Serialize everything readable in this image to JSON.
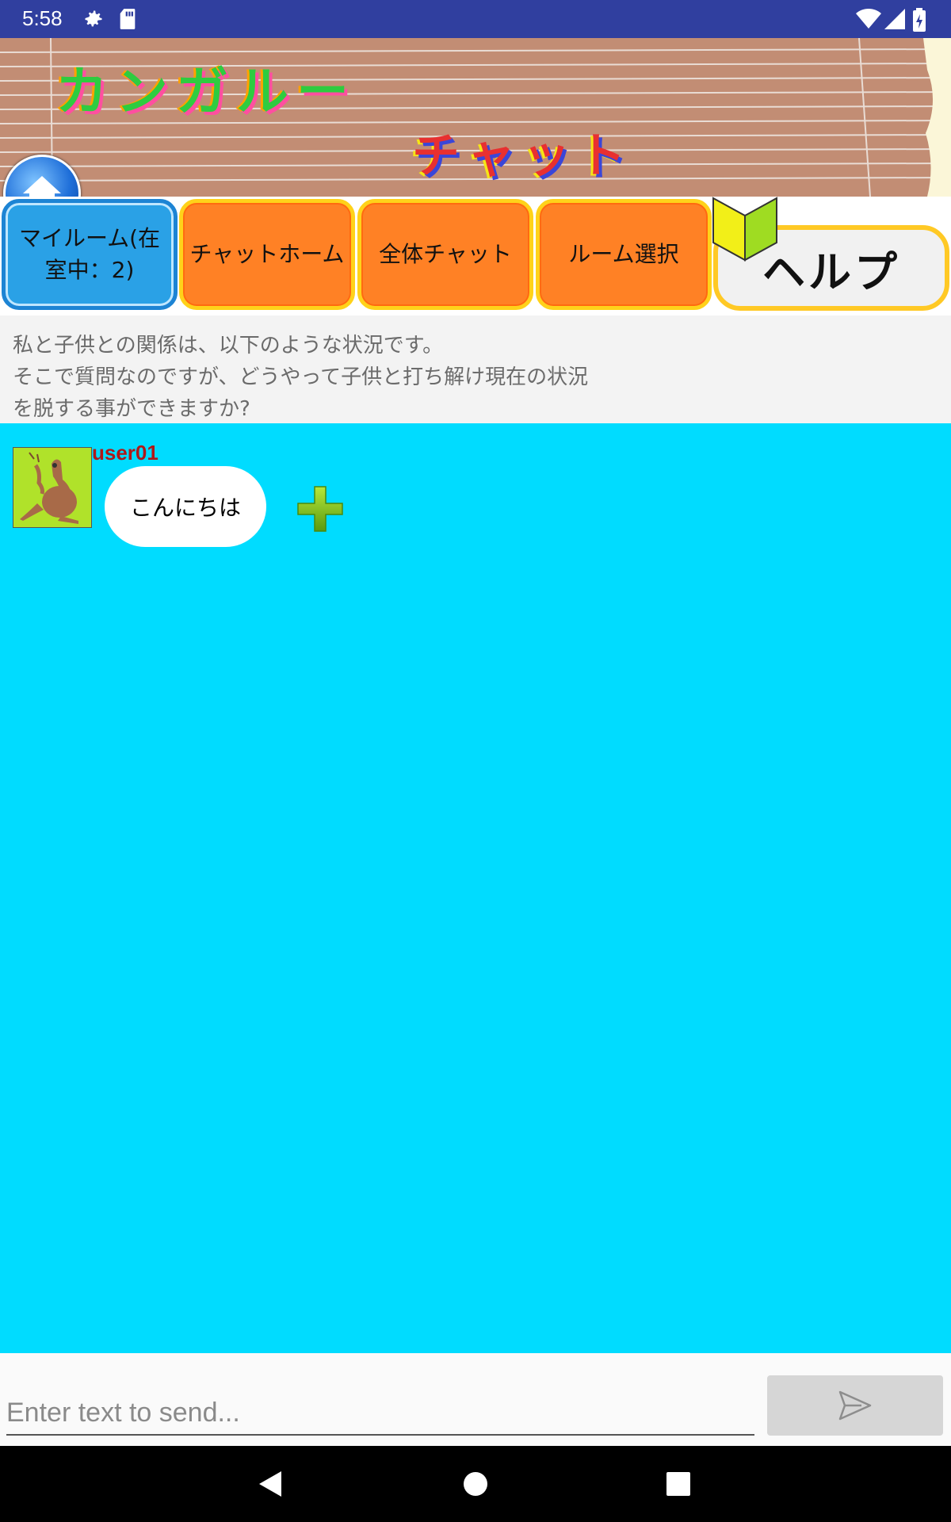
{
  "status_bar": {
    "time": "5:58",
    "icons": [
      "gear-icon",
      "sd-card-icon",
      "wifi-icon",
      "signal-icon",
      "battery-icon"
    ]
  },
  "banner": {
    "title_line1": "カンガルー",
    "title_line2": "チャット",
    "home_icon": "home-icon"
  },
  "nav": {
    "my_room": "マイルーム(在室中：2)",
    "chat_home": "チャットホーム",
    "all_chat": "全体チャット",
    "room_select": "ルーム選択",
    "help": "ヘルプ"
  },
  "topic": {
    "lines": [
      "私と子供との関係は、以下のような状況です。",
      "そこで質問なのですが、どうやって子供と打ち解け現在の状況",
      "を脱する事ができますか?"
    ]
  },
  "messages": [
    {
      "user": "user01",
      "text": "こんにちは"
    }
  ],
  "input": {
    "placeholder": "Enter text to send..."
  },
  "colors": {
    "status_bar": "#303f9f",
    "chat_background": "#00dcff",
    "nav_active": "#2aa1e6",
    "nav_button": "#ff8125",
    "username": "#b01818"
  }
}
